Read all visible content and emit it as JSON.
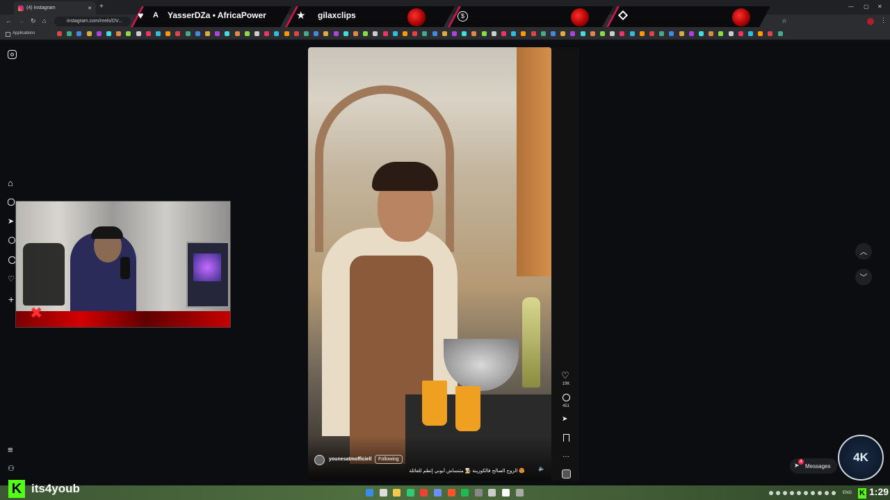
{
  "browser": {
    "tab_title": "(4) Instagram",
    "url": "instagram.com/reels/DV...",
    "bookmarks_label": "Applications"
  },
  "overlay": {
    "segment1": "YasserDZa • AfricaPower",
    "segment1_prefix": "A",
    "segment2": "gilaxclips"
  },
  "reel": {
    "username": "younesatmofficiell",
    "follow_label": "Following",
    "caption": "الزوج الصالح فالكوزينة 👨‍🍳 متنساش أبوني إتطم للعائلة 😍",
    "likes": "19K",
    "comments": "451"
  },
  "messages_label": "Messages",
  "messages_badge": "4",
  "streamer_name": "its4youb",
  "clock": "1:29",
  "lang": "ENG",
  "logo_text": "4K"
}
